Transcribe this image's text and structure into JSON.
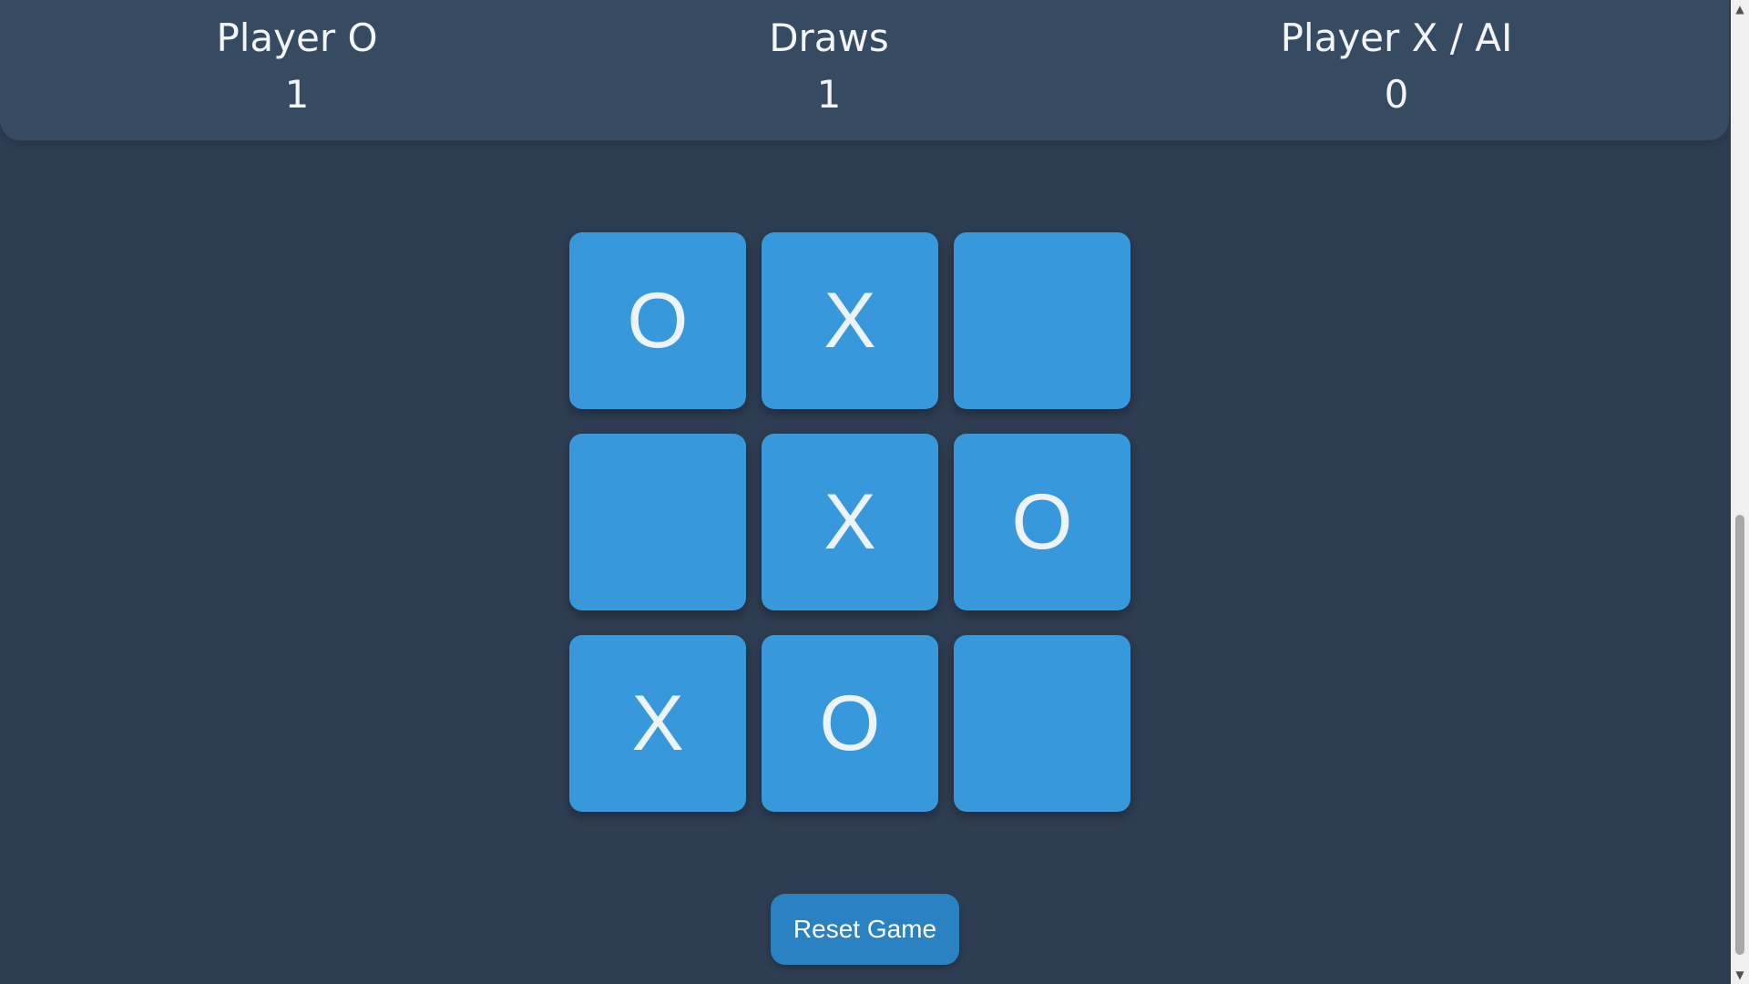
{
  "scoreboard": {
    "player_o": {
      "label": "Player O",
      "value": "1"
    },
    "draws": {
      "label": "Draws",
      "value": "1"
    },
    "player_x": {
      "label": "Player X / AI",
      "value": "0"
    }
  },
  "board": {
    "cells": [
      "O",
      "X",
      "",
      "",
      "X",
      "O",
      "X",
      "O",
      ""
    ]
  },
  "controls": {
    "reset_label": "Reset Game"
  },
  "colors": {
    "background": "#2e3d51",
    "scoreboard": "#364b62",
    "cell": "#3799db",
    "button": "#2b82c3"
  },
  "icons": {
    "scroll_up": "scroll-up-arrow-icon",
    "scroll_down": "scroll-down-arrow-icon"
  }
}
